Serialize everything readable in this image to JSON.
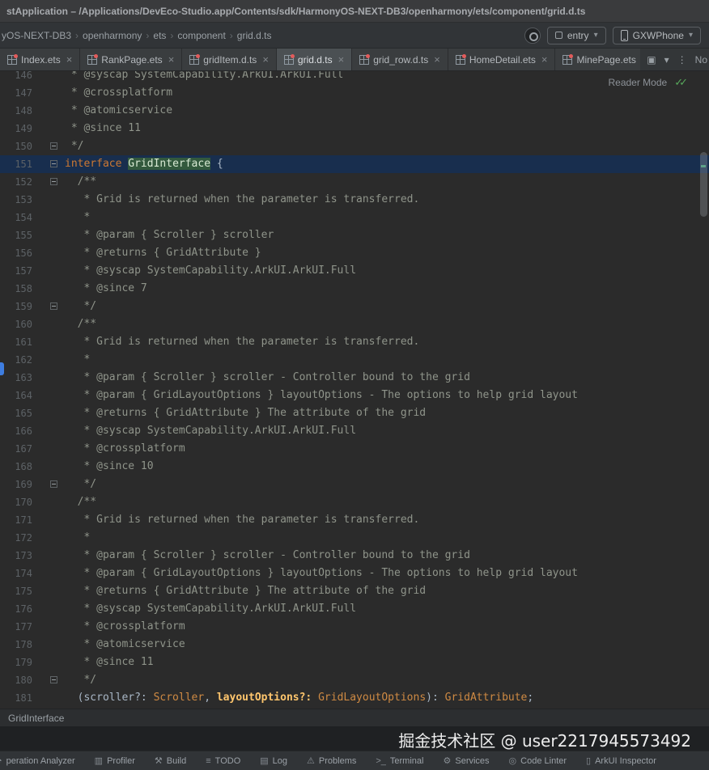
{
  "title_bar": {
    "title": "stApplication – /Applications/DevEco-Studio.app/Contents/sdk/HarmonyOS-NEXT-DB3/openharmony/ets/component/grid.d.ts"
  },
  "navbar": {
    "items": [
      "yOS-NEXT-DB3",
      "openharmony",
      "ets",
      "component",
      "grid.d.ts"
    ],
    "entry_label": "entry",
    "device_label": "GXWPhone"
  },
  "tab_bar": {
    "tabs": [
      {
        "label": "Index.ets",
        "active": false
      },
      {
        "label": "RankPage.ets",
        "active": false
      },
      {
        "label": "gridItem.d.ts",
        "active": false
      },
      {
        "label": "grid.d.ts",
        "active": true
      },
      {
        "label": "grid_row.d.ts",
        "active": false
      },
      {
        "label": "HomeDetail.ets",
        "active": false
      },
      {
        "label": "MinePage.ets",
        "active": false
      }
    ],
    "icons": {
      "list": "▣"
    },
    "overflow_label": "No"
  },
  "editor": {
    "reader_mode_label": "Reader Mode",
    "lines": [
      {
        "n": 146,
        "seg": [
          [
            "cm",
            " * @syscap SystemCapability.ArkUI.ArkUI.Full"
          ]
        ]
      },
      {
        "n": 147,
        "seg": [
          [
            "cm",
            " * @crossplatform"
          ]
        ]
      },
      {
        "n": 148,
        "seg": [
          [
            "cm",
            " * @atomicservice"
          ]
        ]
      },
      {
        "n": 149,
        "seg": [
          [
            "cm",
            " * @since 11"
          ]
        ]
      },
      {
        "n": 150,
        "fold": true,
        "seg": [
          [
            "cm",
            " */"
          ]
        ]
      },
      {
        "n": 151,
        "fold": true,
        "current": true,
        "seg": [
          [
            "kw",
            "interface"
          ],
          [
            "pl",
            " "
          ],
          [
            "hl",
            "GridInterface"
          ],
          [
            "pl",
            " {"
          ]
        ]
      },
      {
        "n": 152,
        "fold": true,
        "seg": [
          [
            "cm",
            "  /**"
          ]
        ]
      },
      {
        "n": 153,
        "seg": [
          [
            "cm",
            "   * Grid is returned when the parameter is transferred."
          ]
        ]
      },
      {
        "n": 154,
        "seg": [
          [
            "cm",
            "   *"
          ]
        ]
      },
      {
        "n": 155,
        "seg": [
          [
            "cm",
            "   * @param { Scroller } scroller"
          ]
        ]
      },
      {
        "n": 156,
        "seg": [
          [
            "cm",
            "   * @returns { GridAttribute }"
          ]
        ]
      },
      {
        "n": 157,
        "seg": [
          [
            "cm",
            "   * @syscap SystemCapability.ArkUI.ArkUI.Full"
          ]
        ]
      },
      {
        "n": 158,
        "seg": [
          [
            "cm",
            "   * @since 7"
          ]
        ]
      },
      {
        "n": 159,
        "fold": true,
        "seg": [
          [
            "cm",
            "   */"
          ]
        ]
      },
      {
        "n": 160,
        "seg": [
          [
            "cm",
            "  /**"
          ]
        ]
      },
      {
        "n": 161,
        "seg": [
          [
            "cm",
            "   * Grid is returned when the parameter is transferred."
          ]
        ]
      },
      {
        "n": 162,
        "seg": [
          [
            "cm",
            "   *"
          ]
        ]
      },
      {
        "n": 163,
        "seg": [
          [
            "cm",
            "   * @param { Scroller } scroller - Controller bound to the grid"
          ]
        ]
      },
      {
        "n": 164,
        "seg": [
          [
            "cm",
            "   * @param { GridLayoutOptions } layoutOptions - The options to help grid layout"
          ]
        ]
      },
      {
        "n": 165,
        "seg": [
          [
            "cm",
            "   * @returns { GridAttribute } The attribute of the grid"
          ]
        ]
      },
      {
        "n": 166,
        "seg": [
          [
            "cm",
            "   * @syscap SystemCapability.ArkUI.ArkUI.Full"
          ]
        ]
      },
      {
        "n": 167,
        "seg": [
          [
            "cm",
            "   * @crossplatform"
          ]
        ]
      },
      {
        "n": 168,
        "seg": [
          [
            "cm",
            "   * @since 10"
          ]
        ]
      },
      {
        "n": 169,
        "fold": true,
        "seg": [
          [
            "cm",
            "   */"
          ]
        ]
      },
      {
        "n": 170,
        "seg": [
          [
            "cm",
            "  /**"
          ]
        ]
      },
      {
        "n": 171,
        "seg": [
          [
            "cm",
            "   * Grid is returned when the parameter is transferred."
          ]
        ]
      },
      {
        "n": 172,
        "seg": [
          [
            "cm",
            "   *"
          ]
        ]
      },
      {
        "n": 173,
        "seg": [
          [
            "cm",
            "   * @param { Scroller } scroller - Controller bound to the grid"
          ]
        ]
      },
      {
        "n": 174,
        "seg": [
          [
            "cm",
            "   * @param { GridLayoutOptions } layoutOptions - The options to help grid layout"
          ]
        ]
      },
      {
        "n": 175,
        "seg": [
          [
            "cm",
            "   * @returns { GridAttribute } The attribute of the grid"
          ]
        ]
      },
      {
        "n": 176,
        "seg": [
          [
            "cm",
            "   * @syscap SystemCapability.ArkUI.ArkUI.Full"
          ]
        ]
      },
      {
        "n": 177,
        "seg": [
          [
            "cm",
            "   * @crossplatform"
          ]
        ]
      },
      {
        "n": 178,
        "seg": [
          [
            "cm",
            "   * @atomicservice"
          ]
        ]
      },
      {
        "n": 179,
        "seg": [
          [
            "cm",
            "   * @since 11"
          ]
        ]
      },
      {
        "n": 180,
        "fold": true,
        "seg": [
          [
            "cm",
            "   */"
          ]
        ]
      },
      {
        "n": 181,
        "seg": [
          [
            "pl",
            "  ("
          ],
          [
            "pl",
            "scroller?: "
          ],
          [
            "ty",
            "Scroller"
          ],
          [
            "pl",
            ", "
          ],
          [
            "pa",
            "layoutOptions?: "
          ],
          [
            "ty",
            "GridLayoutOptions"
          ],
          [
            "pl",
            "): "
          ],
          [
            "ty",
            "GridAttribute"
          ],
          [
            "pl",
            ";"
          ]
        ]
      }
    ]
  },
  "bottom_breadcrumb": "GridInterface",
  "watermark": "掘金技术社区 @ user2217945573492",
  "status_bar": {
    "items": [
      {
        "label": "peration Analyzer",
        "icon": "gauge-icon",
        "glyph": "◔"
      },
      {
        "label": "Profiler",
        "icon": "profiler-icon",
        "glyph": "▥"
      },
      {
        "label": "Build",
        "icon": "hammer-icon",
        "glyph": "⚒"
      },
      {
        "label": "TODO",
        "icon": "todo-list-icon",
        "glyph": "≡"
      },
      {
        "label": "Log",
        "icon": "log-icon",
        "glyph": "▤"
      },
      {
        "label": "Problems",
        "icon": "problems-warning-icon",
        "glyph": "⚠"
      },
      {
        "label": "Terminal",
        "icon": "terminal-icon",
        "glyph": ">_"
      },
      {
        "label": "Services",
        "icon": "services-gear-icon",
        "glyph": "⚙"
      },
      {
        "label": "Code Linter",
        "icon": "linter-icon",
        "glyph": "◎"
      },
      {
        "label": "ArkUI Inspector",
        "icon": "phone-inspector-icon",
        "glyph": "▯"
      }
    ]
  },
  "glyphs": {
    "chevron_down": "▾",
    "kebab": "⋮",
    "double_check": "✓✓",
    "close": "×",
    "crumb_separator": "›"
  },
  "colors": {
    "keyword": "#cc7832",
    "type": "#cf8a43",
    "parameter": "#ffc66d",
    "comment": "#8f948a",
    "plain_text": "#a9b7c6",
    "identifier_highlight_bg": "#32593d",
    "current_line_bg": "#182e4e",
    "inspection_ok_green": "#57a85b",
    "tab_active_bg": "#4b5053",
    "file_badge_red": "#e25b5b",
    "left_marker_blue": "#3e7de0"
  }
}
